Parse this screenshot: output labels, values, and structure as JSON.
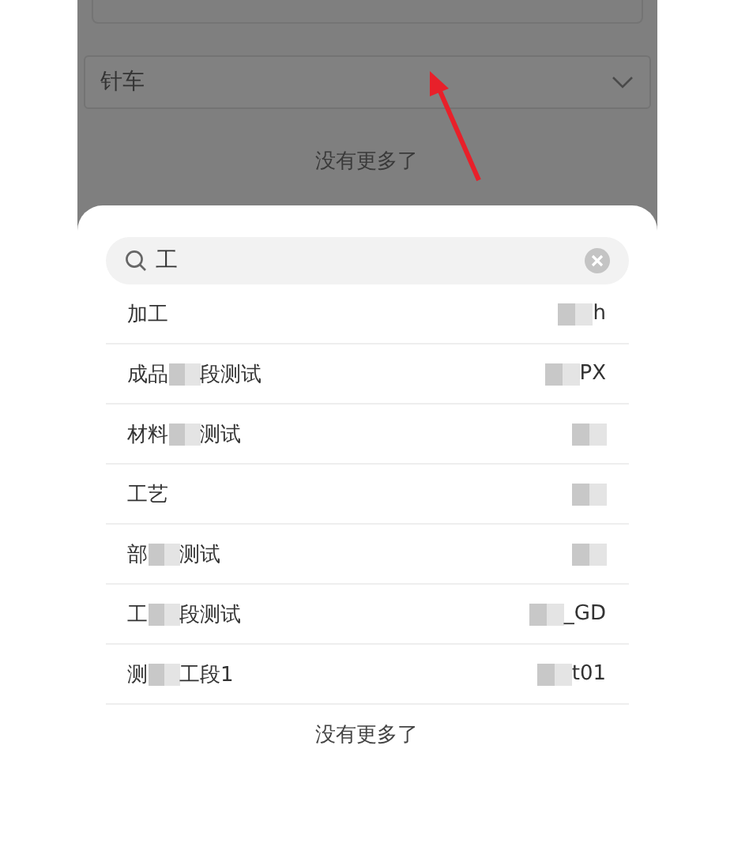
{
  "select": {
    "value": "针车"
  },
  "list_end_top": "没有更多了",
  "search": {
    "value": "工"
  },
  "results": [
    {
      "parts": [
        "加工"
      ],
      "code": "h",
      "redacted": true
    },
    {
      "parts": [
        "成品",
        "段测试"
      ],
      "code": "PX",
      "redacted": true
    },
    {
      "parts": [
        "材料",
        "测试"
      ],
      "redacted": true
    },
    {
      "parts": [
        "工艺"
      ],
      "redacted": true
    },
    {
      "parts": [
        "部",
        "测试"
      ],
      "redacted": true
    },
    {
      "parts": [
        "工",
        "段测试"
      ],
      "code": "_GD",
      "redacted": true
    },
    {
      "parts": [
        "测",
        "工段1"
      ],
      "code": "t01",
      "redacted": true
    }
  ],
  "list_end_bottom": "没有更多了"
}
